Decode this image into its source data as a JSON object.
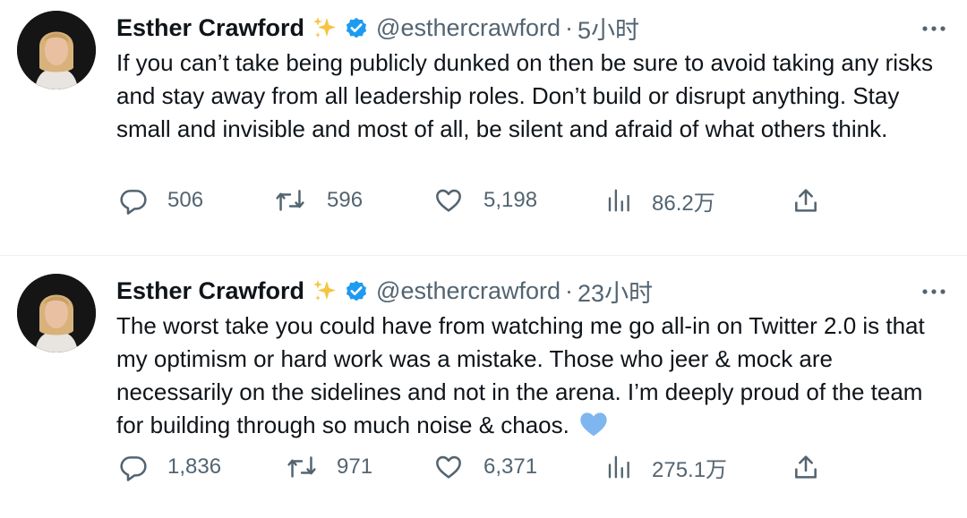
{
  "tweets": [
    {
      "author": {
        "name": "Esther Crawford",
        "name_emoji": "✨",
        "handle": "@esthercrawford"
      },
      "separator": "·",
      "time": "5小时",
      "text": "If you can’t take being publicly dunked on then be sure to avoid taking any risks and stay away from all leadership roles. Don’t build or disrupt anything. Stay small and invisible and most of all, be silent and afraid of what others think.",
      "stats": {
        "replies": "506",
        "retweets": "596",
        "likes": "5,198",
        "views": "86.2万"
      }
    },
    {
      "author": {
        "name": "Esther Crawford",
        "name_emoji": "✨",
        "handle": "@esthercrawford"
      },
      "separator": "·",
      "time": "23小时",
      "text": "The worst take you could have from watching me go all-in on Twitter 2.0 is that my optimism or hard work was a mistake. Those who jeer & mock are necessarily on the sidelines and not in the arena. I’m deeply proud of the team for building through so much noise & chaos.",
      "text_emoji": "💙",
      "stats": {
        "replies": "1,836",
        "retweets": "971",
        "likes": "6,371",
        "views": "275.1万"
      }
    }
  ],
  "colors": {
    "text": "#0f1419",
    "secondary": "#536471",
    "verified": "#1d9bf0",
    "divider": "#eff3f4",
    "heart_emoji": "#7fb6f0",
    "sparkle": "#f5c542"
  },
  "icons": [
    "avatar",
    "sparkle-icon",
    "verified-badge-icon",
    "more-icon",
    "reply-icon",
    "retweet-icon",
    "like-icon",
    "views-icon",
    "share-icon"
  ]
}
